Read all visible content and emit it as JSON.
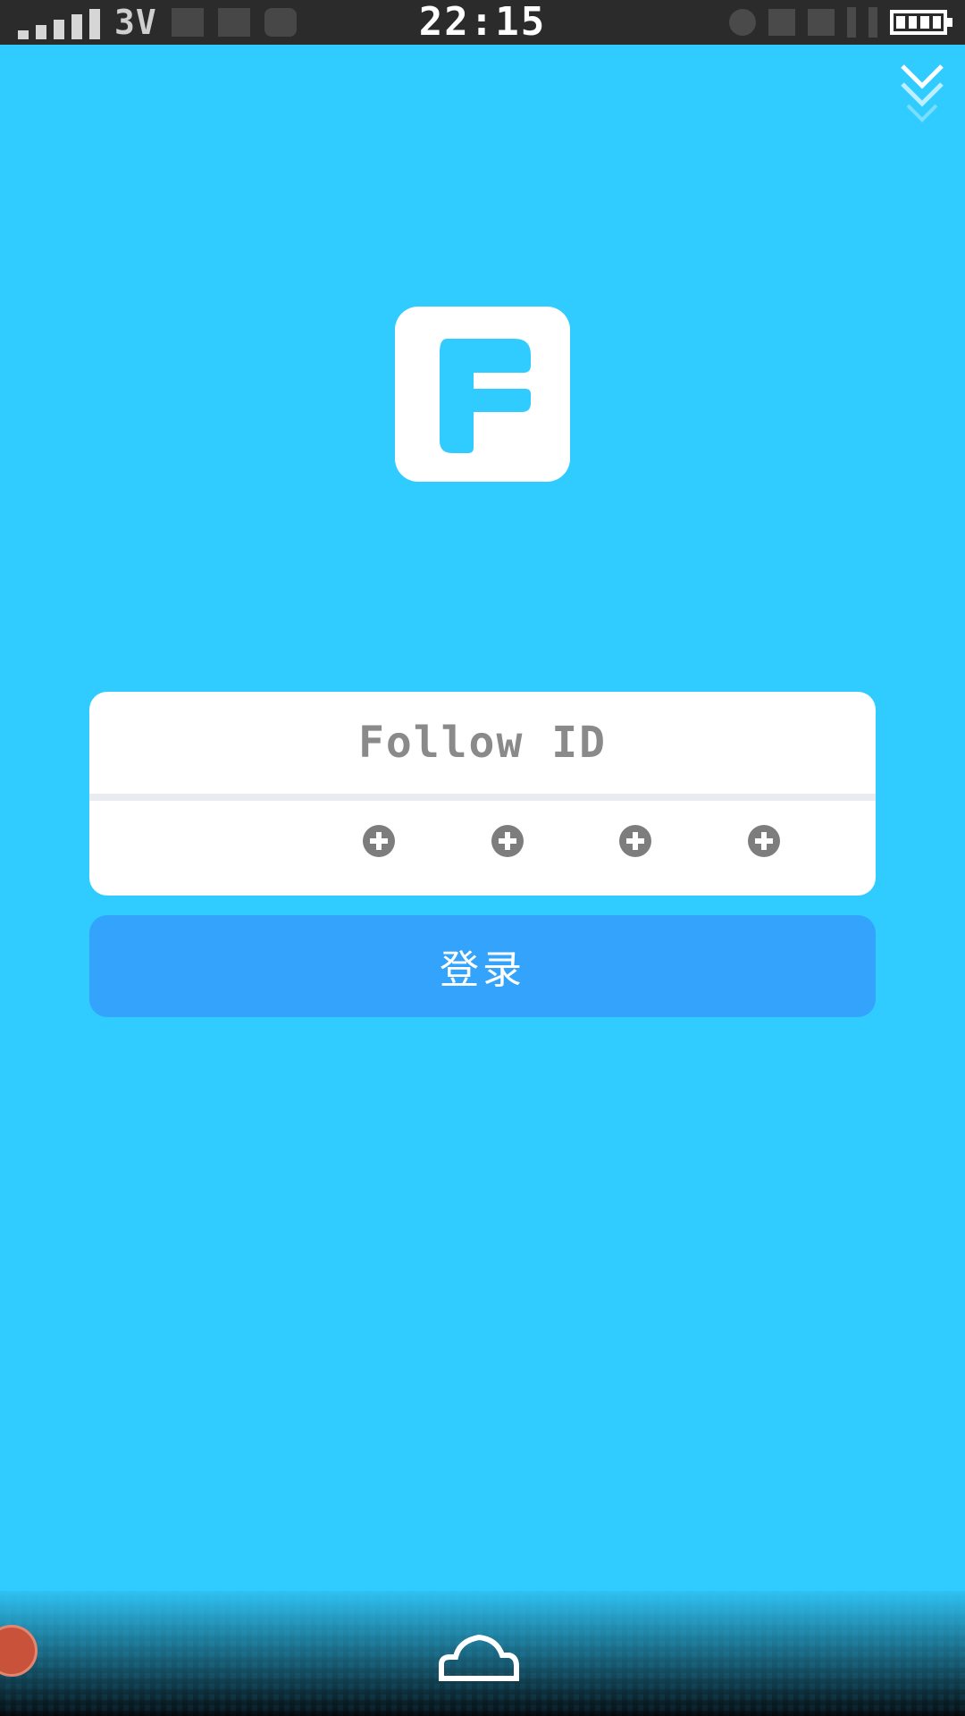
{
  "status_bar": {
    "network_type": "3V",
    "time": "22:15"
  },
  "icons": {
    "collapse": "chevron-double-down-icon",
    "logo": "follow-f-logo",
    "pin_dot": "pin-dot-icon",
    "home": "cloud-home-icon",
    "floating": "floating-ball-icon"
  },
  "login": {
    "id_placeholder": "Follow ID",
    "pin_length": 4,
    "submit_label": "登录"
  },
  "colors": {
    "background": "#31ccff",
    "button": "#33a3fc",
    "card": "#ffffff",
    "placeholder_text": "#8a8a8a"
  }
}
